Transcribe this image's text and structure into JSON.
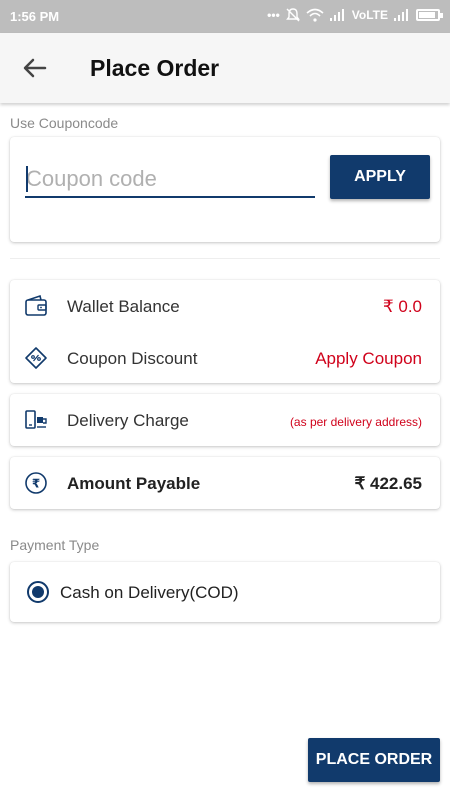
{
  "status_bar": {
    "time": "1:56 PM",
    "network_label": "VoLTE",
    "battery_level": 0.9,
    "icons": [
      "more-dots-icon",
      "mute-icon",
      "wifi-icon",
      "signal-icon",
      "signal-icon",
      "battery-icon"
    ]
  },
  "app_bar": {
    "title": "Place Order",
    "back_icon": "arrow-left-icon"
  },
  "coupon": {
    "section_label": "Use Couponcode",
    "placeholder": "Coupon code",
    "value": "",
    "apply_label": "APPLY"
  },
  "summary": {
    "wallet": {
      "label": "Wallet Balance",
      "value": "₹ 0.0",
      "icon": "wallet-icon"
    },
    "coupon_discount": {
      "label": "Coupon Discount",
      "value": "Apply Coupon",
      "icon": "coupon-tag-icon"
    },
    "delivery": {
      "label": "Delivery Charge",
      "value": "(as per delivery address)",
      "icon": "delivery-icon"
    },
    "amount": {
      "label": "Amount Payable",
      "value": "₹ 422.65",
      "icon": "rupee-icon"
    }
  },
  "payment": {
    "section_label": "Payment Type",
    "options": [
      {
        "label": "Cash on Delivery(COD)",
        "selected": true
      }
    ]
  },
  "place_order_label": "PLACE ORDER",
  "colors": {
    "primary": "#113a6c",
    "accent_red": "#d0021b",
    "status_bar": "#bdbdbd",
    "app_bar": "#f6f6f6"
  }
}
